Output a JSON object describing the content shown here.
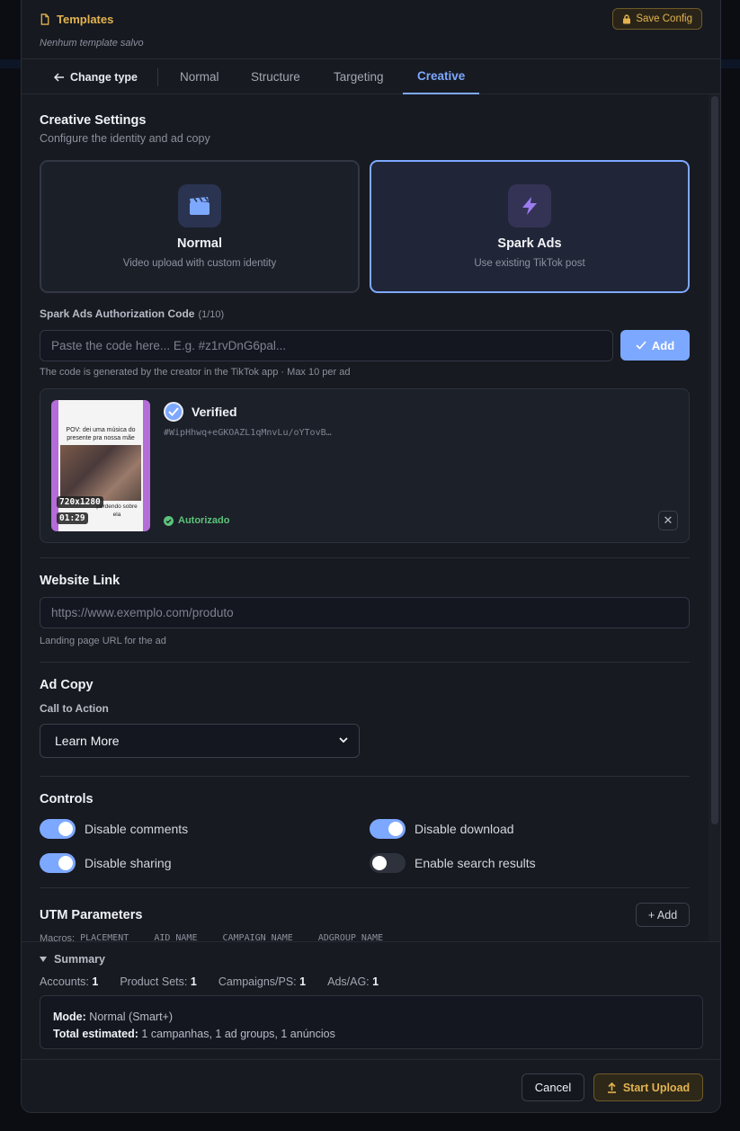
{
  "templates": {
    "title": "Templates",
    "empty_text": "Nenhum template salvo",
    "save_label": "Save Config"
  },
  "tabs": {
    "back_label": "Change type",
    "items": [
      "Normal",
      "Structure",
      "Targeting",
      "Creative"
    ],
    "active": "Creative"
  },
  "creative": {
    "title": "Creative Settings",
    "subtitle": "Configure the identity and ad copy",
    "options": [
      {
        "name": "Normal",
        "desc": "Video upload with custom identity",
        "icon": "clapperboard-icon",
        "selected": false
      },
      {
        "name": "Spark Ads",
        "desc": "Use existing TikTok post",
        "icon": "lightning-icon",
        "selected": true
      }
    ]
  },
  "spark": {
    "label": "Spark Ads Authorization Code",
    "count": "(1/10)",
    "placeholder": "Paste the code here... E.g. #z1rvDnG6pal...",
    "add_label": "Add",
    "hint": "The code is generated by the creator in the TikTok app · Max 10 per ad",
    "post": {
      "status": "Verified",
      "code": "#WipHhwq+eGKOAZL1qMnvLu/oYTovB…",
      "authorized": "Autorizado",
      "resolution": "720x1280",
      "duration": "01:29",
      "caption": "POV: dei uma música do presente pra nossa mãe",
      "caption2": "perdendo sobre ela"
    }
  },
  "website": {
    "title": "Website Link",
    "placeholder": "https://www.exemplo.com/produto",
    "hint": "Landing page URL for the ad"
  },
  "ad_copy": {
    "title": "Ad Copy",
    "cta_label": "Call to Action",
    "cta_value": "Learn More"
  },
  "controls": {
    "title": "Controls",
    "items": [
      {
        "label": "Disable comments",
        "on": true
      },
      {
        "label": "Disable download",
        "on": true
      },
      {
        "label": "Disable sharing",
        "on": true
      },
      {
        "label": "Enable search results",
        "on": false
      }
    ]
  },
  "utm": {
    "title": "UTM Parameters",
    "add_label": "+ Add",
    "macros_label": "Macros:",
    "macros": [
      "PLACEMENT",
      "AID_NAME",
      "CAMPAIGN_NAME",
      "ADGROUP_NAME"
    ]
  },
  "summary": {
    "title": "Summary",
    "stats": [
      {
        "label": "Accounts:",
        "value": "1"
      },
      {
        "label": "Product Sets:",
        "value": "1"
      },
      {
        "label": "Campaigns/PS:",
        "value": "1"
      },
      {
        "label": "Ads/AG:",
        "value": "1"
      }
    ],
    "mode_label": "Mode:",
    "mode_value": "Normal (Smart+)",
    "total_label": "Total estimated:",
    "total_value": "1 campanhas, 1 ad groups, 1 anúncios"
  },
  "footer": {
    "cancel_label": "Cancel",
    "start_label": "Start Upload"
  },
  "colors": {
    "accent": "#7da8ff",
    "gold": "#e2b34f",
    "success": "#5cc27a",
    "background": "#171a21"
  }
}
